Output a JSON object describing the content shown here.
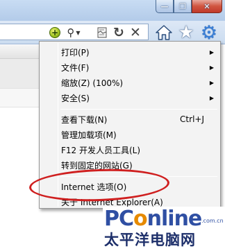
{
  "window": {
    "minimize_glyph": "—",
    "restore_glyph": "❐",
    "close_glyph": "✕"
  },
  "toolbar": {
    "compat_glyph": "+",
    "search_glyph": "⚲",
    "search_dropdown_glyph": "▼",
    "refresh_glyph": "↻",
    "stop_glyph": "✕",
    "favorites_glyph": "★",
    "tools_glyph": "⚙",
    "icons": [
      "compatibility-icon",
      "search-icon",
      "compatibility-view-icon",
      "refresh-icon",
      "stop-icon",
      "home-icon",
      "favorites-star-icon",
      "tools-gear-icon"
    ]
  },
  "tools_menu": {
    "items": [
      {
        "label": "打印(P)",
        "has_submenu": true
      },
      {
        "label": "文件(F)",
        "has_submenu": true
      },
      {
        "label": "缩放(Z) (100%)",
        "has_submenu": true
      },
      {
        "label": "安全(S)",
        "has_submenu": true
      },
      {
        "label": "查看下载(N)",
        "shortcut": "Ctrl+J"
      },
      {
        "label": "管理加载项(M)"
      },
      {
        "label": "F12 开发人员工具(L)"
      },
      {
        "label": "转到固定的网站(G)"
      },
      {
        "label": "Internet 选项(O)"
      },
      {
        "label": "关于 Internet Explorer(A)"
      }
    ],
    "submenu_arrow": "▶",
    "highlighted_item": "Internet 选项(O)",
    "highlight_color": "#cf1f1f"
  },
  "watermark": {
    "logo_pc": "PC",
    "logo_o": "o",
    "logo_rest": "nline",
    "domain": ".com.cn",
    "chinese_name": "太平洋电脑网"
  },
  "colors": {
    "menu_background": "#f3f3f3",
    "toolbar_background": "#dde8f6",
    "close_button": "#d0543f",
    "watermark_blue": "#2f4fa3",
    "watermark_orange": "#e68a00"
  }
}
